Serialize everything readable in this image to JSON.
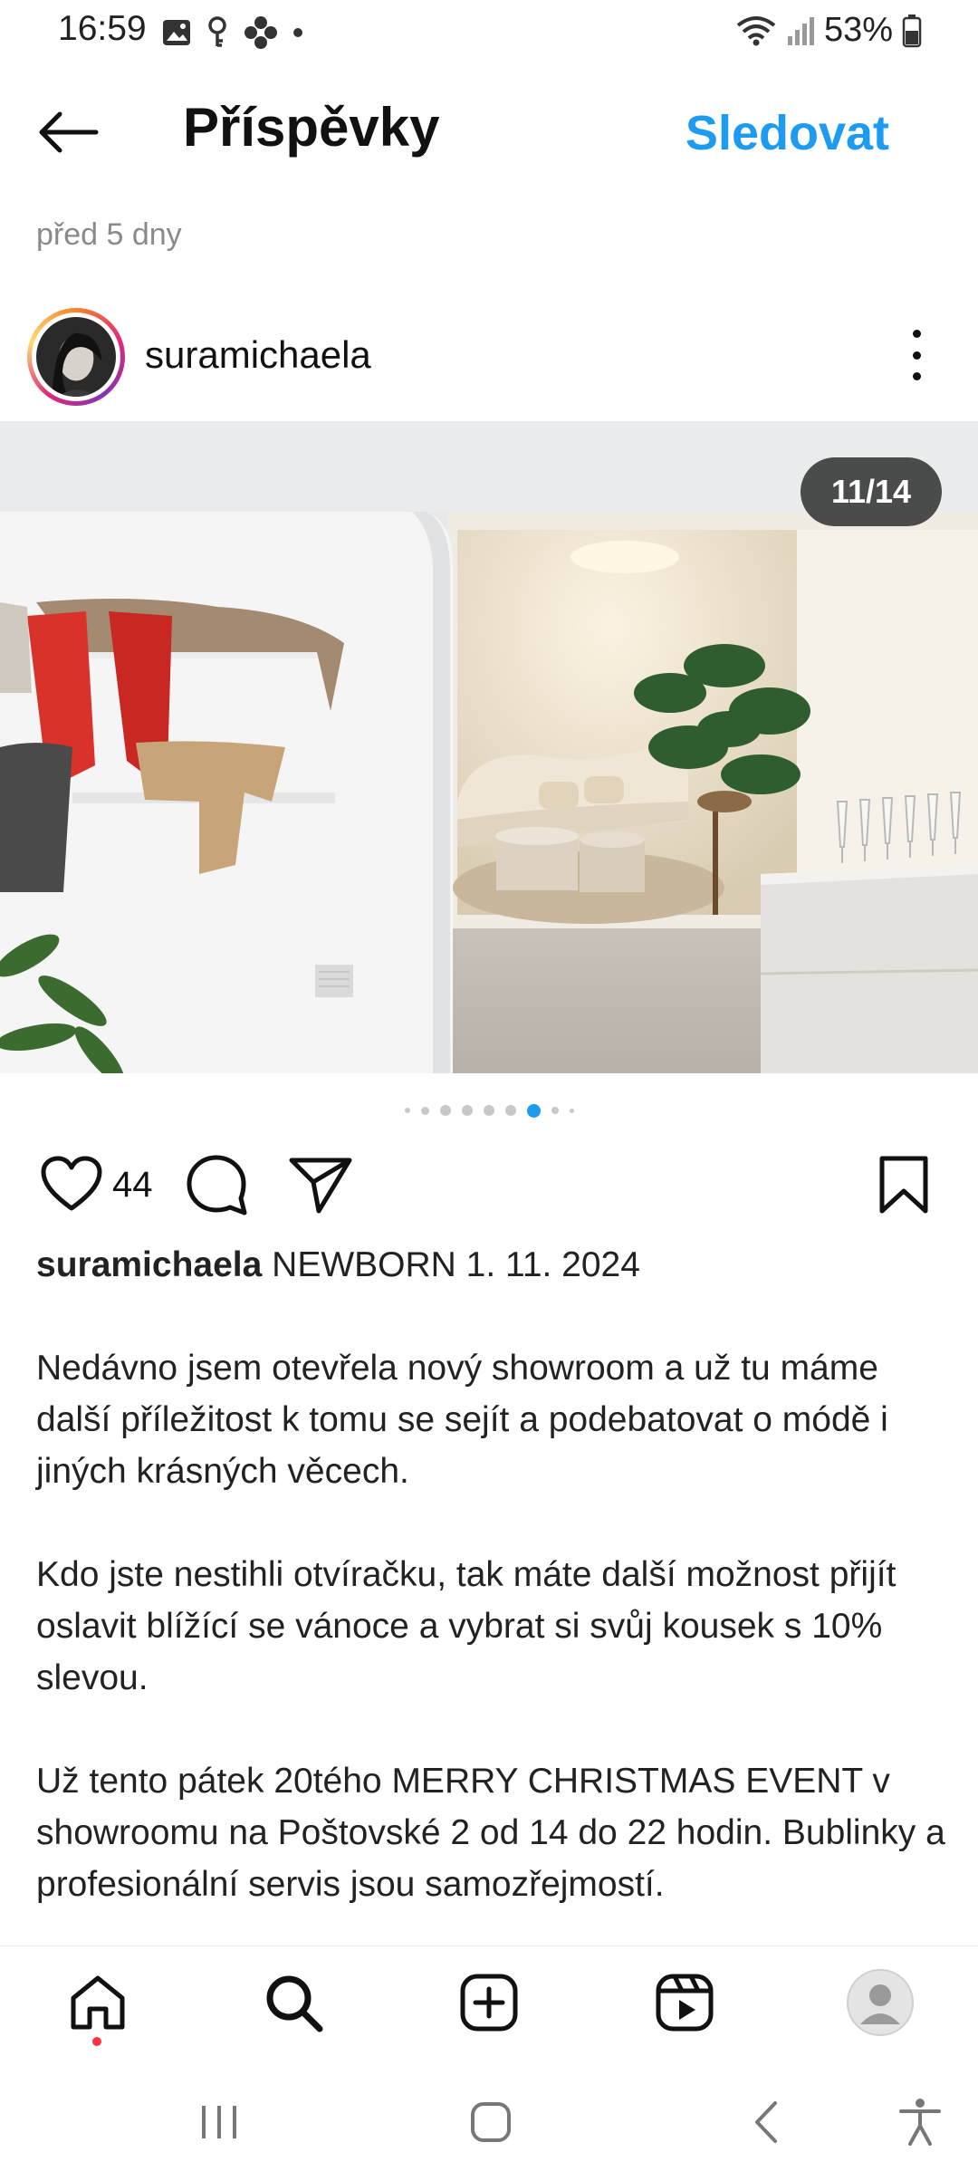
{
  "status_bar": {
    "time": "16:59",
    "battery": "53%",
    "icons_left": [
      "image-notification-icon",
      "key-icon",
      "pinwheel-icon",
      "dot-icon"
    ],
    "icons_right": [
      "wifi-icon",
      "signal-icon",
      "battery-icon"
    ]
  },
  "header": {
    "title": "Příspěvky",
    "follow_label": "Sledovat",
    "back_icon": "arrow-left-icon"
  },
  "post": {
    "age": "před 5 dny",
    "author": "suramichaela",
    "image_counter": "11/14",
    "carousel": {
      "current": 6,
      "dots_visible": 8
    },
    "likes": "44",
    "caption_user": "suramichaela",
    "caption_first_line": "NEWBORN 1. 11. 2024",
    "caption_paragraphs": [
      "Nedávno jsem otevřela nový showroom a už tu máme další příležitost k tomu se sejít a podebatovat o módě i jiných krásných věcech.",
      "Kdo jste nestihli otvíračku, tak máte další možnost přijít oslavit blížící se vánoce a vybrat si svůj kousek s 10% slevou.",
      "Už tento pátek 20tého MERRY CHRISTMAS EVENT v showroomu na Poštovské 2 od 14 do 22 hodin. Bublinky a profesionální servis jsou samozřejmostí."
    ]
  },
  "bottom_nav": [
    "home-icon",
    "search-icon",
    "create-icon",
    "reels-icon",
    "profile-icon"
  ],
  "colors": {
    "accent": "#1d9bf0",
    "notification": "#ff3040"
  }
}
